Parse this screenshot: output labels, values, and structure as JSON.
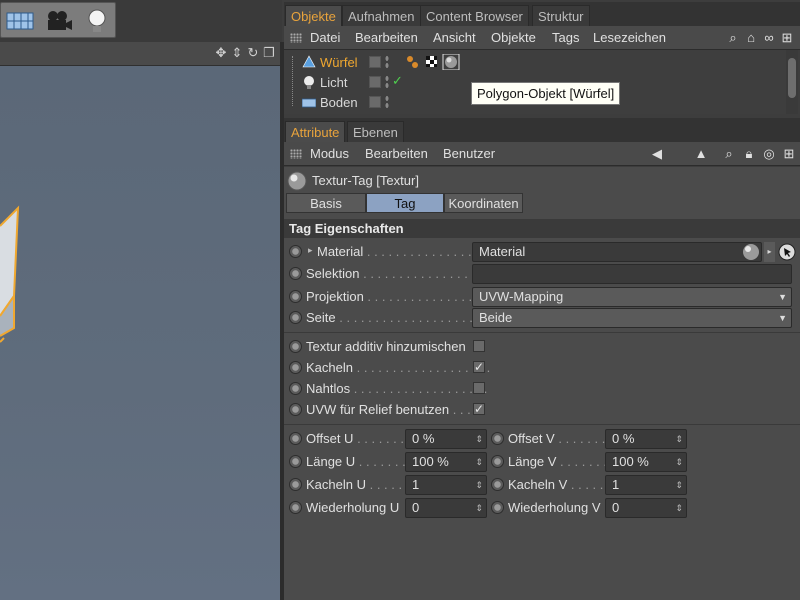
{
  "manager_tabs": [
    "Objekte",
    "Aufnahmen",
    "Content Browser",
    "Struktur"
  ],
  "object_menu": [
    "Datei",
    "Bearbeiten",
    "Ansicht",
    "Objekte",
    "Tags",
    "Lesezeichen"
  ],
  "objects": [
    {
      "name": "Würfel",
      "selected": true,
      "icon": "cube-icon"
    },
    {
      "name": "Licht",
      "selected": false,
      "icon": "light-icon"
    },
    {
      "name": "Boden",
      "selected": false,
      "icon": "floor-icon"
    }
  ],
  "tooltip": "Polygon-Objekt [Würfel]",
  "attr_tabs": [
    "Attribute",
    "Ebenen"
  ],
  "attr_menu": [
    "Modus",
    "Bearbeiten",
    "Benutzer"
  ],
  "tag_title": "Textur-Tag [Textur]",
  "sub_tabs": [
    "Basis",
    "Tag",
    "Koordinaten"
  ],
  "active_sub_tab": "Tag",
  "section_title": "Tag Eigenschaften",
  "props": {
    "material": {
      "label": "Material",
      "value": "Material"
    },
    "selection": {
      "label": "Selektion",
      "value": ""
    },
    "projection": {
      "label": "Projektion",
      "value": "UVW-Mapping"
    },
    "side": {
      "label": "Seite",
      "value": "Beide"
    },
    "additive": {
      "label": "Textur additiv hinzumischen",
      "checked": false
    },
    "tile": {
      "label": "Kacheln",
      "checked": true
    },
    "seamless": {
      "label": "Nahtlos",
      "checked": false
    },
    "uvw_relief": {
      "label": "UVW für Relief benutzen",
      "checked": true
    }
  },
  "grid": {
    "offset_u": {
      "label": "Offset U",
      "value": "0 %"
    },
    "offset_v": {
      "label": "Offset V",
      "value": "0 %"
    },
    "length_u": {
      "label": "Länge U",
      "value": "100 %"
    },
    "length_v": {
      "label": "Länge V",
      "value": "100 %"
    },
    "tiles_u": {
      "label": "Kacheln U",
      "value": "1"
    },
    "tiles_v": {
      "label": "Kacheln V",
      "value": "1"
    },
    "repeat_u": {
      "label": "Wiederholung U",
      "value": "0"
    },
    "repeat_v": {
      "label": "Wiederholung V",
      "value": "0"
    }
  },
  "colors": {
    "active_tab": "#e8a33c",
    "selected_object": "#f0a830",
    "active_subtab": "#8ca2c2",
    "viewport": "#5f6c7c"
  }
}
